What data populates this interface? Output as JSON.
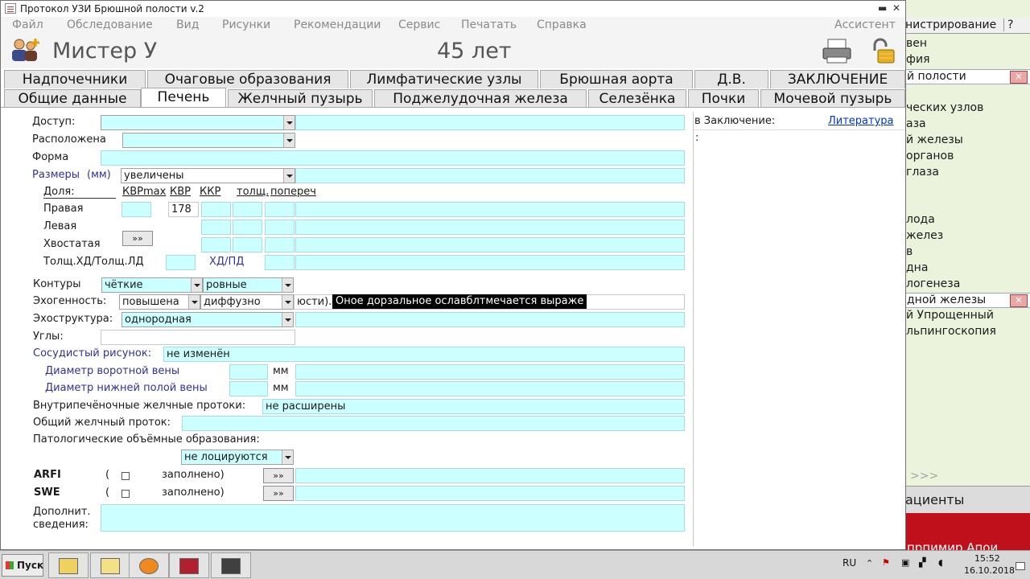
{
  "window": {
    "title": "Протокол УЗИ Брюшной полости v.2",
    "controls": [
      "▲",
      "▬",
      "▵",
      "✕"
    ]
  },
  "menu": [
    "Файл",
    "Обследование",
    "Вид",
    "Рисунки",
    "Рекомендации",
    "Сервис",
    "Печатать",
    "Справка",
    "Ассистент"
  ],
  "header": {
    "patient_name": "Мистер У",
    "age": "45 лет"
  },
  "tabs_row1": [
    "Надпочечники",
    "Очаговые образования",
    "Лимфатические узлы",
    "Брюшная аорта",
    "Д.В.",
    "ЗАКЛЮЧЕНИЕ"
  ],
  "tabs_row2": [
    "Общие данные",
    "Печень",
    "Желчный пузырь",
    "Поджелудочная железа",
    "Селезёнка",
    "Почки",
    "Мочевой пузырь"
  ],
  "active_tab": "Печень",
  "form": {
    "access_label": "Доступ:",
    "location_label": "Расположена",
    "shape_label": "Форма",
    "size_label": "Размеры",
    "size_unit": "(мм)",
    "size_value": "увеличены",
    "lobe_header": "Доля:",
    "col_kvrmax": "КВРmax",
    "col_kvr": "КВР",
    "col_kkr": "ККР",
    "col_thick": "толщ.",
    "col_cross": "попереч",
    "lobe_right": "Правая",
    "lobe_left": "Левая",
    "lobe_caudate": "Хвостатая",
    "right_kvr": "178",
    "more_btn": "»»",
    "ratio_label": "Толщ.ХД/Толщ.ЛД",
    "hd_pd_label": "ХД/ПД",
    "contours_label": "Контуры",
    "contours_1": "чёткие",
    "contours_2": "ровные",
    "echo_label": "Эхогенность:",
    "echo_1": "повышена",
    "echo_2": "диффузно",
    "echo_text": "юсти).",
    "tooltip": "Оное дорзальное ославблтмечается выраже",
    "structure_label": "Эхоструктура:",
    "structure_value": "однородная",
    "corners_label": "Углы:",
    "vascular_label": "Сосудистый рисунок:",
    "vascular_value": "не изменён",
    "portal_label": "Диаметр воротной вены",
    "ivc_label": "Диаметр нижней полой вены",
    "mm": "мм",
    "ducts_label": "Внутрипечёночные желчные протоки:",
    "ducts_value": "не расширены",
    "cbd_label": "Общий желчный проток:",
    "lesions_label": "Патологические объёмные образования:",
    "lesions_value": "не лоцируются",
    "arfi_label": "ARFI",
    "swe_label": "SWE",
    "paren": "(",
    "filled": "заполнено)",
    "extra_label_1": "Дополнит.",
    "extra_label_2": "сведения:"
  },
  "right_pane": {
    "to_conclusion": "в Заключение:",
    "literature": "Литература",
    "text": ":"
  },
  "background_window": {
    "menu": [
      "нистрирование",
      "?"
    ],
    "rows": [
      "вен",
      "фия",
      "й полости",
      "",
      "ческих узлов",
      "аза",
      "й железы",
      "органов",
      "глаза",
      "",
      "",
      "лода",
      "желез",
      "в",
      "дна",
      "логенеза",
      "дной железы",
      "й Упрощенный",
      "льпингоскопия"
    ],
    "more": ">>>",
    "patients": "ациенты",
    "red_text": "прпимир Апои"
  },
  "taskbar": {
    "start": "Пуск",
    "lang": "RU",
    "time": "15:52",
    "date": "16.10.2018"
  },
  "colors": {
    "field": "#ccffff",
    "accent_link": "#0033cc",
    "label_blue": "#3030a0",
    "red_bar": "#c0101c"
  }
}
